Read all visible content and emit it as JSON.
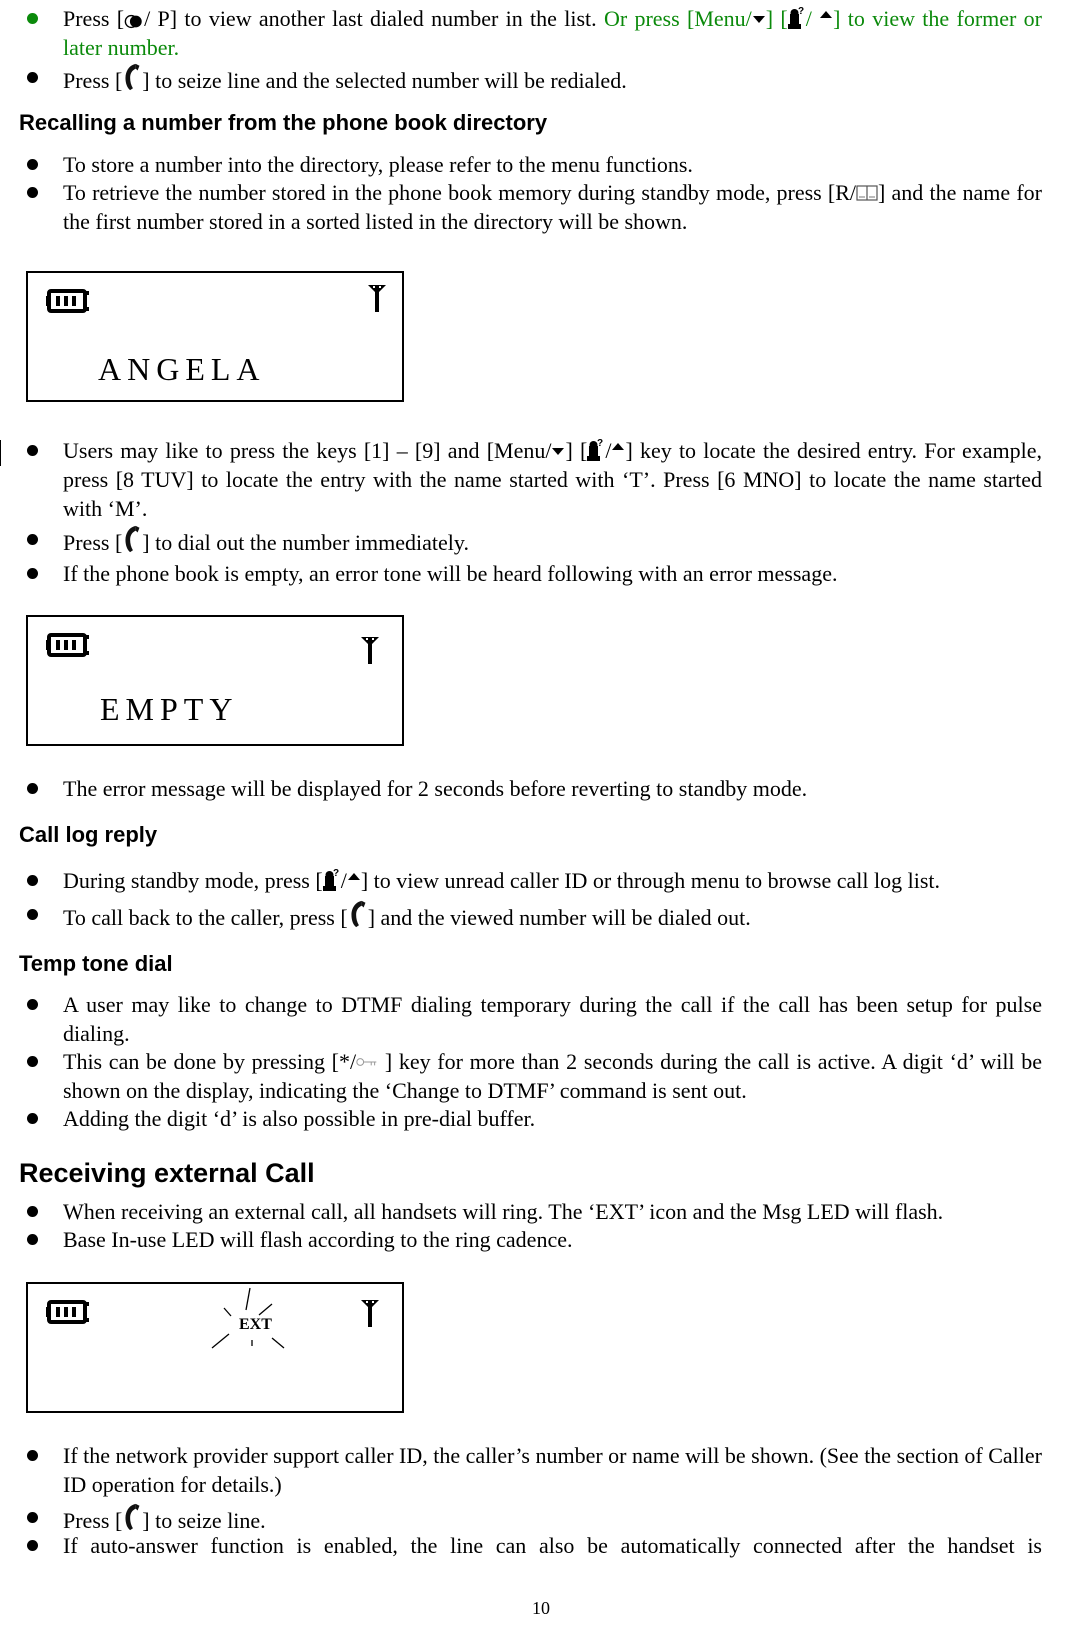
{
  "page": {
    "number": "10"
  },
  "colors": {
    "highlight_green": "#0b8a0b",
    "text": "#000000"
  },
  "intro_bullets": [
    {
      "pre": "Press [",
      "icon1": "redial-pause-icon",
      "mid": "/ P] to view another last dialed number in the list. ",
      "green": "Or press [Menu/",
      "green_icon_down": "arrow-down-icon",
      "green2": "] [",
      "green_icon_cid": "caller-id-icon",
      "green3": "/ ",
      "green_icon_up": "arrow-up-icon",
      "green4": "] to view the former or later number."
    },
    {
      "pre": "Press [",
      "icon": "phone-handset-icon",
      "post": "] to seize line and the selected number will be redialed."
    }
  ],
  "sections": {
    "recall": {
      "title": "Recalling a number from the phone book directory",
      "bullets": [
        {
          "text": "To store a number into the directory, please refer to the menu functions."
        },
        {
          "pre": "To retrieve the number stored in the phone book memory during standby mode, press [R/",
          "icon": "phonebook-icon",
          "post": "] and the name for the first number stored in a sorted listed in the directory will be shown."
        }
      ],
      "lcd1": {
        "text": "ANGELA",
        "battery_icon": "battery-icon",
        "antenna_icon": "antenna-icon"
      },
      "bullets2": [
        {
          "pre": "Users may like to press the keys [1] – [9] and [Menu/",
          "icon_down": "arrow-down-icon",
          "mid": "] [",
          "icon_cid": "caller-id-icon",
          "mid2": "/",
          "icon_up": "arrow-up-icon",
          "post": "] key to locate the desired entry. For example, press [8 TUV] to locate the entry with the name started with ‘T’. Press [6 MNO] to locate the name started with ‘M’."
        },
        {
          "pre": "Press [",
          "icon": "phone-handset-icon",
          "post": "] to dial out the number immediately."
        },
        {
          "text": "If the phone book is empty, an error tone will be heard following with an error message."
        }
      ],
      "lcd2": {
        "text": "EMPTY"
      },
      "bullets3": [
        {
          "text": "The error message will be displayed for 2 seconds before reverting to standby mode."
        }
      ]
    },
    "calllog": {
      "title": "Call log reply",
      "bullets": [
        {
          "pre": "During standby mode, press [",
          "icon_cid": "caller-id-icon",
          "mid": "/",
          "icon_up": "arrow-up-icon",
          "post": "] to view unread caller ID or through menu to browse call log list."
        },
        {
          "pre": "To call back to the caller, press [",
          "icon": "phone-handset-icon",
          "post": "] and the viewed number will be dialed out."
        }
      ]
    },
    "temptone": {
      "title": "Temp tone dial",
      "bullets": [
        {
          "text": "A user may like to change to DTMF dialing temporary during the call if the call has been setup for pulse dialing."
        },
        {
          "pre": "This can be done by pressing [*/",
          "icon": "key-lock-icon",
          "post": " ] key for more than 2 seconds during the call is active. A digit ‘d’ will be shown on the display, indicating the ‘Change to DTMF’ command is sent out."
        },
        {
          "text": "Adding the digit ‘d’ is also possible in pre-dial buffer."
        }
      ]
    },
    "receiving": {
      "title": "Receiving external Call",
      "bullets": [
        {
          "text": "When receiving an external call, all handsets will ring. The ‘EXT’ icon and the Msg LED will flash."
        },
        {
          "text": "Base In-use LED will flash according to the ring cadence."
        }
      ],
      "lcd3": {
        "ext_label": "EXT"
      },
      "bullets2": [
        {
          "text": "If the network provider support caller ID, the caller’s number or name will be shown. (See the section of Caller ID operation for details.)"
        },
        {
          "pre": "Press [",
          "icon": "phone-handset-icon",
          "post": "] to seize line."
        },
        {
          "text": "If auto-answer function is enabled, the line can also be automatically connected after the handset is"
        }
      ]
    }
  }
}
